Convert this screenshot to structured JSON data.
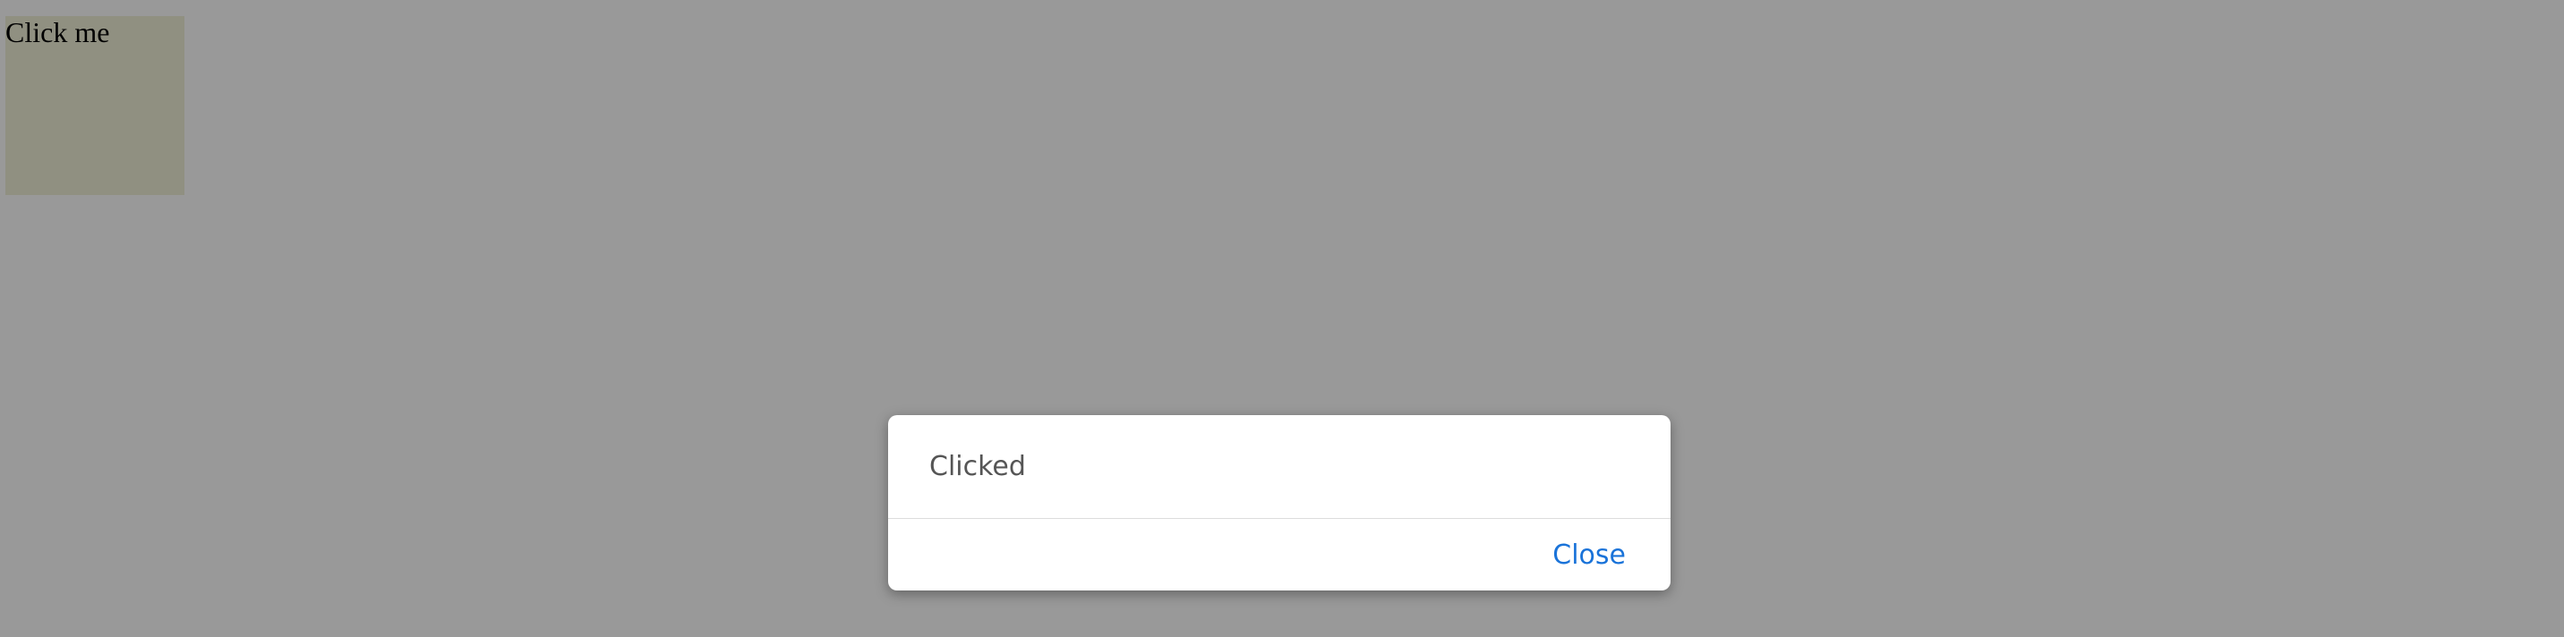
{
  "page": {
    "click_box_label": "Click me"
  },
  "dialog": {
    "message": "Clicked",
    "close_label": "Close"
  },
  "colors": {
    "click_box_bg": "#f1f0d8",
    "overlay": "rgba(0,0,0,0.4)",
    "link_blue": "#1a73d9"
  }
}
